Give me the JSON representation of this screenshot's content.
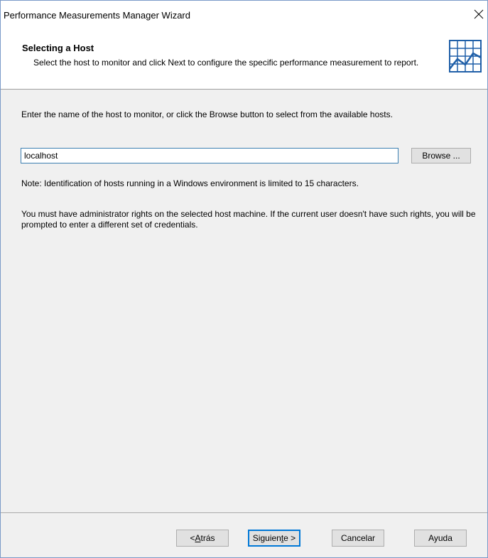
{
  "window": {
    "title": "Performance Measurements Manager Wizard",
    "close_glyph": "✕"
  },
  "header": {
    "title": "Selecting a Host",
    "subtitle": "Select the host to monitor and click Next to configure the specific performance measurement to report.",
    "icon": "performance-chart-icon"
  },
  "main": {
    "instruction": "Enter the name of the host to monitor, or click the Browse button to select from the available hosts.",
    "host_input": {
      "value": "localhost",
      "placeholder": ""
    },
    "browse_label": "Browse ...",
    "note": "Note: Identification of hosts running in a Windows environment is limited to 15 characters.",
    "rights": "You must have administrator rights on the selected host machine. If the current user doesn't have such rights, you will be prompted to enter a different set of credentials."
  },
  "footer": {
    "back": {
      "pre": "< ",
      "accel": "A",
      "post": "trás"
    },
    "next": {
      "pre": "Siguien",
      "accel": "t",
      "post": "e >"
    },
    "cancel_label": "Cancelar",
    "help_label": "Ayuda"
  },
  "colors": {
    "body_bg": "#f0f0f0",
    "input_border": "#3c7fb1",
    "default_button_border": "#0078d7",
    "icon_color": "#1f5fa8"
  }
}
